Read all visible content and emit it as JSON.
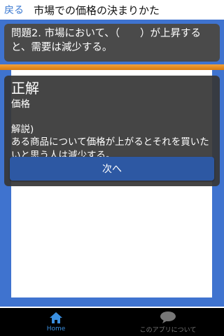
{
  "header": {
    "back_label": "戻る",
    "title": "市場での価格の決まりかた"
  },
  "question": {
    "text": "問題2. 市場において、（　　）が上昇すると、需要は減少する。"
  },
  "answer": {
    "heading": "正解",
    "value": "価格",
    "explanation_label": "解説)",
    "explanation_text": "ある商品について価格が上がるとそれを買いたいと思う人は減少する。",
    "next_label": "次へ"
  },
  "tabs": [
    {
      "label": "Home",
      "icon": "home-icon",
      "active": true
    },
    {
      "label": "このアプリについて",
      "icon": "chat-bubble-icon",
      "active": false
    }
  ],
  "colors": {
    "accent": "#3a78d0",
    "background_blue": "#3f73cf",
    "button": "#2d58a3",
    "bar": "#e8901f"
  }
}
